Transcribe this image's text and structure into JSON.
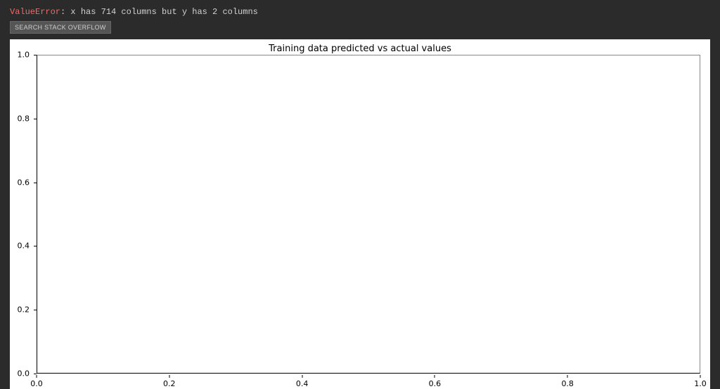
{
  "error": {
    "type": "ValueError",
    "message": ": x has 714 columns but y has 2 columns"
  },
  "buttons": {
    "search_so": "SEARCH STACK OVERFLOW"
  },
  "chart_data": {
    "type": "line",
    "title": "Training data predicted vs actual values",
    "xlabel": "",
    "ylabel": "",
    "x_ticks": [
      "0.0",
      "0.2",
      "0.4",
      "0.6",
      "0.8",
      "1.0"
    ],
    "y_ticks": [
      "0.0",
      "0.2",
      "0.4",
      "0.6",
      "0.8",
      "1.0"
    ],
    "xlim": [
      0.0,
      1.0
    ],
    "ylim": [
      0.0,
      1.0
    ],
    "series": []
  }
}
